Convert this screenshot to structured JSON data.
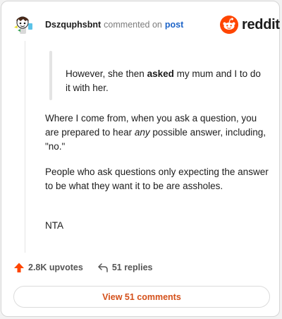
{
  "colors": {
    "reddit_orange": "#ff4500",
    "link_blue": "#1d64c8",
    "button_text": "#d4501a",
    "text": "#1c1c1c",
    "muted": "#7c7c7c"
  },
  "icons": {
    "avatar": "snoo-avatar",
    "brand": "reddit-logo-icon",
    "upvote": "upvote-arrow-icon",
    "reply": "reply-arrow-icon"
  },
  "header": {
    "username": "Dszquphsbnt",
    "action": "commented on",
    "post_link": "post",
    "brand_word": "reddit"
  },
  "comment": {
    "quote_before": "However, she then ",
    "quote_emphasis": "asked",
    "quote_after": " my mum and I to do it with her.",
    "p1_before": "Where I come from, when you ask a question, you are prepared to hear ",
    "p1_emphasis": "any",
    "p1_after": " possible answer, including, \"no.\"",
    "p2": "People who ask questions only expecting the answer to be what they want it to be are assholes.",
    "p3": "NTA"
  },
  "stats": {
    "upvotes": "2.8K upvotes",
    "replies": "51 replies"
  },
  "footer": {
    "view_comments": "View 51 comments"
  }
}
